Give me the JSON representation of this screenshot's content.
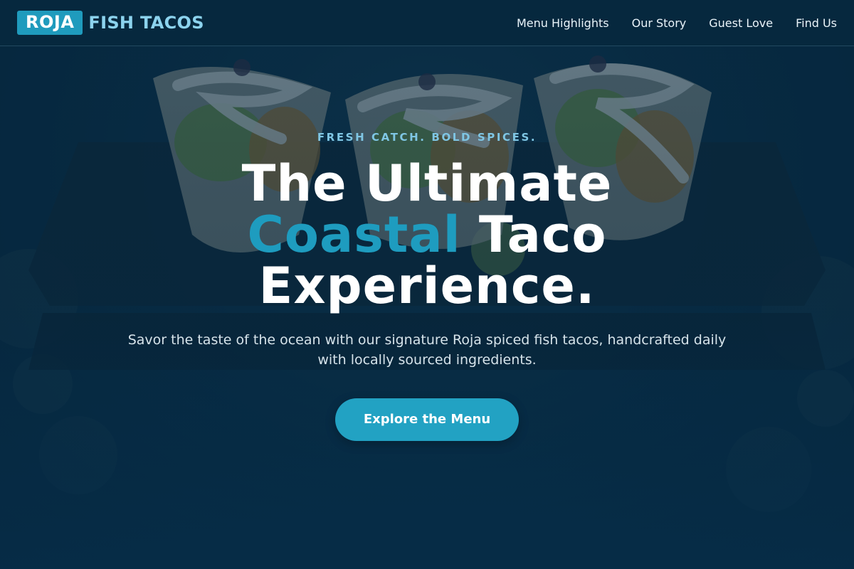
{
  "header": {
    "logo_badge": "ROJA",
    "logo_text": "FISH TACOS",
    "nav": [
      {
        "label": "Menu Highlights"
      },
      {
        "label": "Our Story"
      },
      {
        "label": "Guest Love"
      },
      {
        "label": "Find Us"
      }
    ]
  },
  "hero": {
    "eyebrow": "FRESH CATCH. BOLD SPICES.",
    "headline_line1": "The Ultimate",
    "headline_accent": "Coastal",
    "headline_line2_rest": " Taco",
    "headline_line3": "Experience.",
    "subtext": "Savor the taste of the ocean with our signature Roja spiced fish tacos, handcrafted daily with locally sourced ingredients.",
    "cta_label": "Explore the Menu",
    "image": "fish-tacos-photo"
  },
  "colors": {
    "background": "#062f4a",
    "accent": "#1e9cbf",
    "logo_text": "#8cd3ee",
    "eyebrow": "#7fc6e4",
    "cta": "#22a2c3"
  }
}
